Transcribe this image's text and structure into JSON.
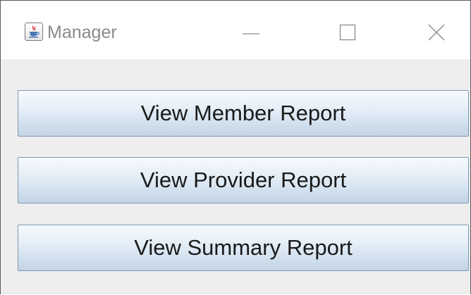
{
  "window": {
    "title": "Manager",
    "icon": "java-cup-icon",
    "controls": {
      "minimize_icon": "minimize-icon",
      "maximize_icon": "maximize-icon",
      "close_icon": "close-icon"
    }
  },
  "buttons": {
    "member_report": "View Member Report",
    "provider_report": "View Provider Report",
    "summary_report": "View Summary Report"
  },
  "colors": {
    "content_background": "#eeeeee",
    "button_border": "#7e98b3",
    "button_gradient_top": "#f7fafd",
    "button_gradient_bottom": "#c3d4e6",
    "title_text": "#8a8a8a"
  }
}
